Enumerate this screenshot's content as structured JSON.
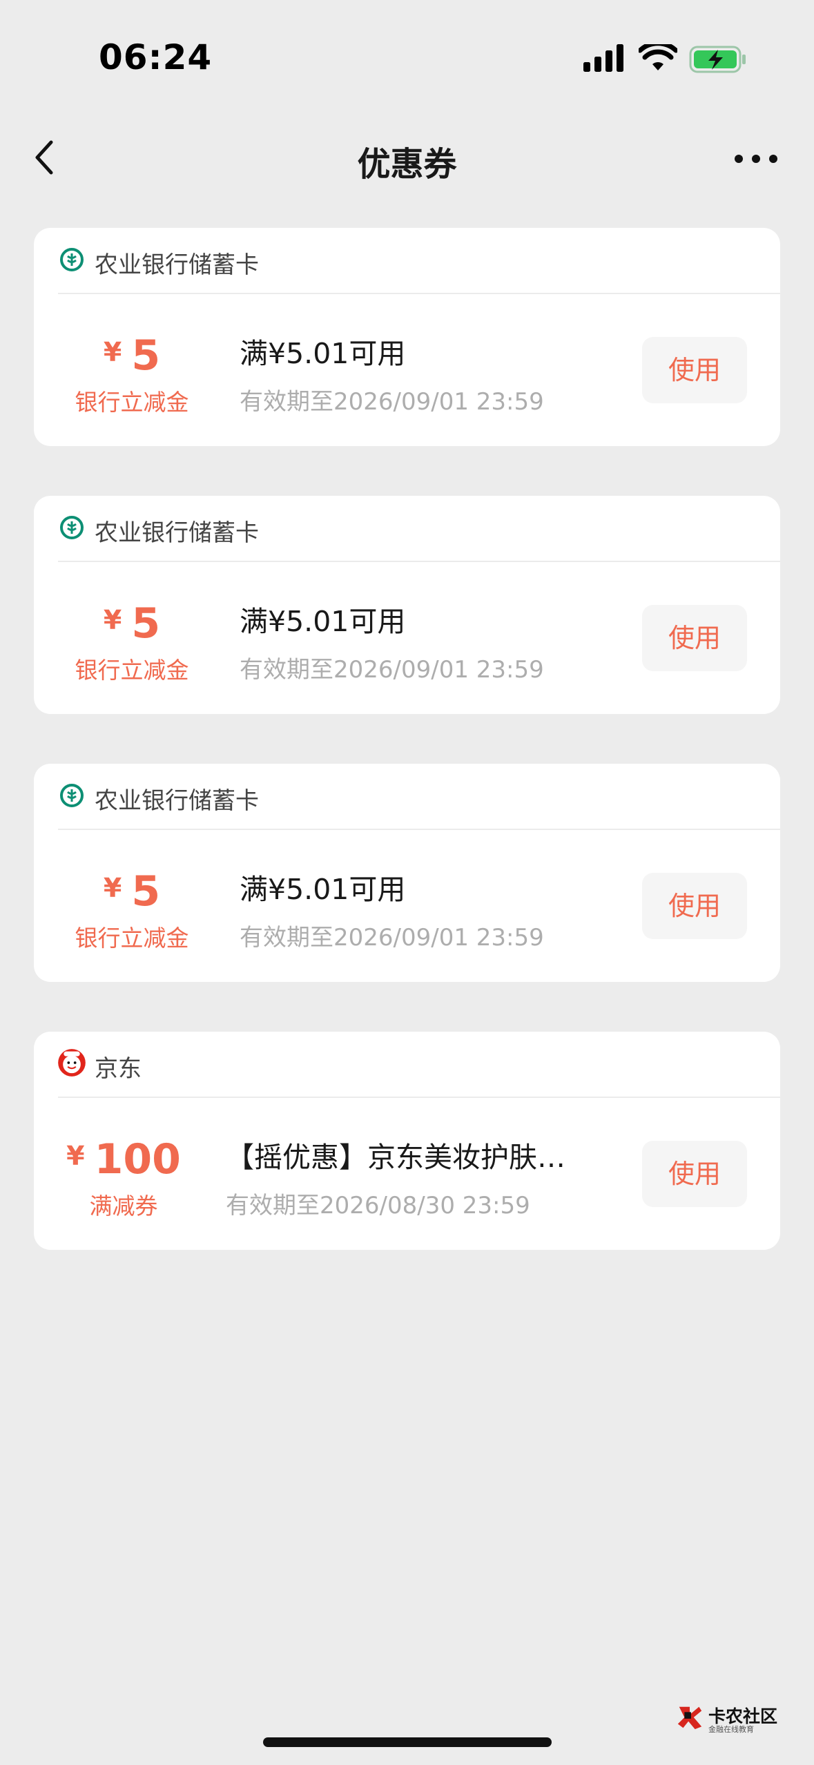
{
  "status_bar": {
    "time": "06:24"
  },
  "nav": {
    "title": "优惠券"
  },
  "colors": {
    "accent": "#f06a4f",
    "background": "#ececec",
    "battery": "#34c759",
    "abc_green": "#0d8f74",
    "jd_red": "#e1251b"
  },
  "coupons": [
    {
      "merchant_icon": "abc-bank-icon",
      "merchant": "农业银行储蓄卡",
      "currency": "¥",
      "amount": "5",
      "amount_label": "银行立减金",
      "title": "满¥5.01可用",
      "validity": "有效期至2026/09/01 23:59",
      "button": "使用"
    },
    {
      "merchant_icon": "abc-bank-icon",
      "merchant": "农业银行储蓄卡",
      "currency": "¥",
      "amount": "5",
      "amount_label": "银行立减金",
      "title": "满¥5.01可用",
      "validity": "有效期至2026/09/01 23:59",
      "button": "使用"
    },
    {
      "merchant_icon": "abc-bank-icon",
      "merchant": "农业银行储蓄卡",
      "currency": "¥",
      "amount": "5",
      "amount_label": "银行立减金",
      "title": "满¥5.01可用",
      "validity": "有效期至2026/09/01 23:59",
      "button": "使用"
    },
    {
      "merchant_icon": "jd-logo-icon",
      "merchant": "京东",
      "currency": "¥",
      "amount": "100",
      "amount_label": "满减券",
      "title": "【摇优惠】京东美妆护肤…",
      "validity": "有效期至2026/08/30 23:59",
      "button": "使用"
    }
  ],
  "watermark": {
    "title": "卡农社区",
    "subtitle": "金融在线教育"
  }
}
